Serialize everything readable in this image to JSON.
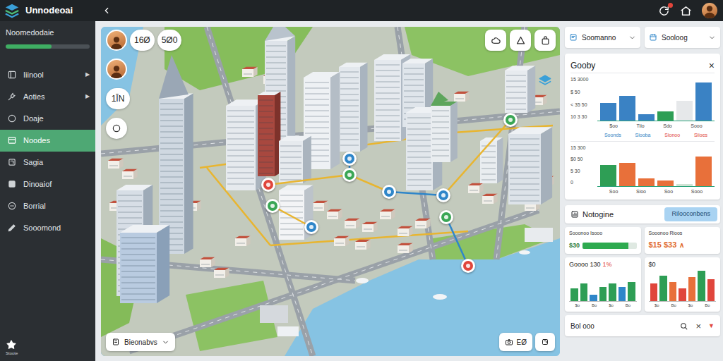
{
  "app": {
    "title": "Unnodeoai"
  },
  "sidebar": {
    "title": "Noomedodaie",
    "level": 0.55,
    "items": [
      {
        "label": "Iiinool",
        "kind": "group",
        "arrow": "▶",
        "selected": false
      },
      {
        "label": "Aoties",
        "kind": "group",
        "arrow": "▶",
        "selected": false
      },
      {
        "label": "Doaje",
        "kind": "link",
        "selected": false
      },
      {
        "label": "Noodes",
        "kind": "link",
        "selected": true
      },
      {
        "label": "Sagia",
        "kind": "link",
        "selected": false
      },
      {
        "label": "Dinoaiof",
        "kind": "link",
        "selected": false
      },
      {
        "label": "Borrial",
        "kind": "link",
        "selected": false
      },
      {
        "label": "Sooomond",
        "kind": "link",
        "selected": false
      }
    ],
    "footer": "Stoote"
  },
  "map": {
    "chips": [
      "16Ø",
      "5Ø0"
    ],
    "side_chip": "1ĪN",
    "layer_select": "Bieonabvs",
    "zoom": "EØ",
    "pins": [
      {
        "color": "#e0463c"
      },
      {
        "color": "#3aa655"
      },
      {
        "color": "#2f86c9"
      },
      {
        "color": "#3aa655"
      },
      {
        "color": "#2f86c9"
      },
      {
        "color": "#2f86c9"
      },
      {
        "color": "#3aa655"
      },
      {
        "color": "#3aa655"
      },
      {
        "color": "#2f86c9"
      },
      {
        "color": "#e0463c"
      }
    ]
  },
  "filters": [
    "Soomanno",
    "Sooloog"
  ],
  "chart_card": {
    "title": "Gooby",
    "close": "×",
    "top": {
      "ticks": [
        "15 3000",
        "$ 50",
        "< 35 50",
        "10 3 30"
      ],
      "values": [
        40,
        55,
        15,
        20,
        45,
        85
      ],
      "colors": [
        "#3a82c4",
        "#3a82c4",
        "#3a82c4",
        "#2e9e55",
        "#e6e8ea",
        "#3a82c4"
      ],
      "labels": [
        "$oo",
        "Tiio",
        "Sdo",
        "Sooo"
      ]
    },
    "legend": [
      {
        "label": "Soonds",
        "color": "#2f7fc2"
      },
      {
        "label": "Siooba",
        "color": "#2f7fc2"
      },
      {
        "label": "Sionoo",
        "color": "#e0463c"
      },
      {
        "label": "Siioes",
        "color": "#e0463c"
      }
    ],
    "bottom": {
      "ticks": [
        "15 300",
        "$0 50",
        "5 30",
        "0"
      ],
      "values": [
        50,
        55,
        18,
        12,
        5,
        70
      ],
      "colors": [
        "#2e9e55",
        "#e8703a",
        "#e8703a",
        "#e8703a",
        "#cfe3d4",
        "#e8703a"
      ],
      "labels": [
        "Soo",
        "Sioo",
        "Soo",
        "Sooo"
      ]
    }
  },
  "summary": {
    "title": "Notogine",
    "action": "Rilooconbens",
    "stats": [
      {
        "kind": "bar",
        "title": "Sooonoo Isooo",
        "value": "$30",
        "level": 0.85
      },
      {
        "kind": "trend",
        "title": "Sooonoo Rioos",
        "value": "$15 $33",
        "trend": "∧"
      }
    ],
    "charts": [
      {
        "title": "Goooo 130",
        "delta": "1%",
        "values": [
          40,
          55,
          20,
          45,
          55,
          45,
          60
        ],
        "colors": [
          "#2e9e55",
          "#2e9e55",
          "#2f86c9",
          "#2e9e55",
          "#2e9e55",
          "#2f86c9",
          "#2e9e55"
        ],
        "labels": [
          "$o",
          "Bo",
          "$o",
          "Bo"
        ]
      },
      {
        "title": "$0",
        "delta": "",
        "values": [
          55,
          80,
          60,
          40,
          75,
          95,
          70
        ],
        "colors": [
          "#e0463c",
          "#2e9e55",
          "#e8703a",
          "#e0463c",
          "#e8703a",
          "#2e9e55",
          "#e0463c"
        ],
        "labels": [
          "$o",
          "Bo",
          "$o",
          "Bo"
        ]
      }
    ]
  },
  "footer_bar": {
    "label": "Bol ooo",
    "clear": "×",
    "sort": "▼"
  }
}
